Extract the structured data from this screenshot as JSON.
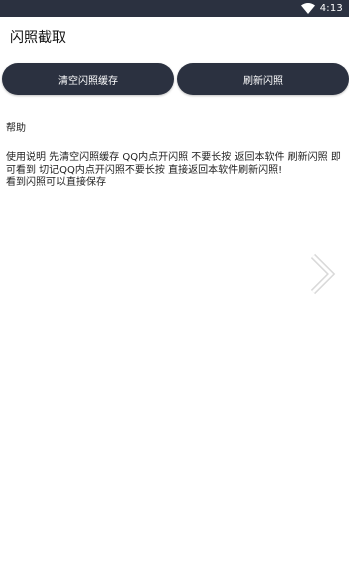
{
  "status_bar": {
    "time": "4:13",
    "wifi_icon": "wifi-icon"
  },
  "app": {
    "title": "闪照截取"
  },
  "buttons": {
    "clear_cache": "清空闪照缓存",
    "refresh": "刷新闪照"
  },
  "help": {
    "title": "帮助",
    "text": "使用说明 先清空闪照缓存 QQ内点开闪照 不要长按 返回本软件 刷新闪照 即可看到 切记QQ内点开闪照不要长按 直接返回本软件刷新闪照!\n看到闪照可以直接保存"
  },
  "colors": {
    "bar": "#2b3140",
    "button_bg": "#2b3140",
    "button_text": "#ffffff",
    "background": "#ffffff"
  },
  "icons": {
    "next": "chevron-right-icon"
  }
}
